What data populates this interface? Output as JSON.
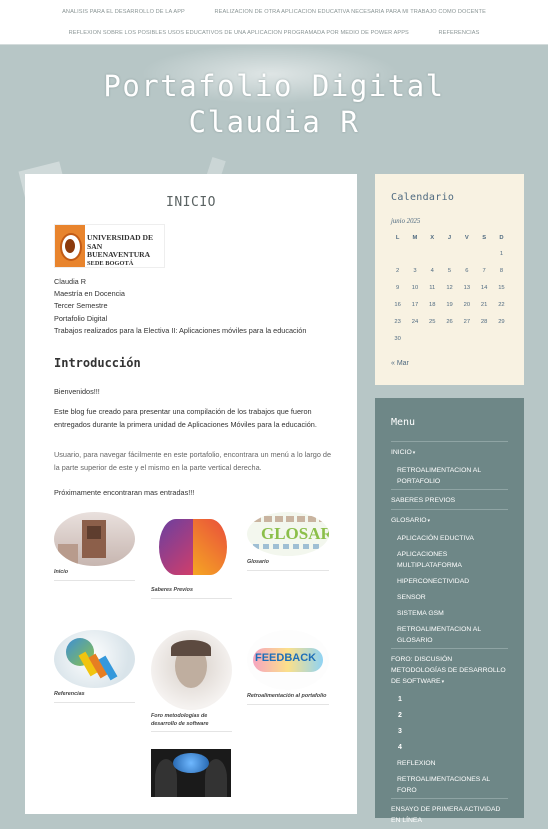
{
  "nav": {
    "row1": [
      "ANALISIS PARA EL DESARROLLO DE LA APP",
      "REALIZACION DE OTRA APLICACION EDUCATIVA NECESARIA PARA MI TRABAJO COMO DOCENTE"
    ],
    "row2": [
      "REFLEXION SOBRE LOS POSIBLES USOS EDUCATIVOS DE UNA APLICACION PROGRAMADA POR MEDIO DE POWER APPS",
      "REFERENCIAS"
    ]
  },
  "site": {
    "title_line1": "Portafolio Digital",
    "title_line2": "Claudia R"
  },
  "post": {
    "title": "INICIO",
    "logo_text": [
      "UNIVERSIDAD DE",
      "SAN BUENAVENTURA",
      "SEDE BOGOTÁ"
    ],
    "info_lines": [
      "Claudia R",
      "Maestría en Docencia",
      "Tercer Semestre",
      "Portafolio Digital",
      "Trabajos realizados para la Electiva II: Aplicaciones móviles para la educación"
    ],
    "intro_heading": "Introducción",
    "welcome": "Bienvenidos!!!",
    "para1": "Este blog fue creado para presentar una compilación de los trabajos que fueron entregados durante la primera unidad de Aplicaciones Móviles para la educación.",
    "para2": "Usuario, para navegar fácilmente en este portafolio, encontrara un menú a lo largo de la parte superior de este y el mismo en la parte vertical derecha.",
    "para3": "Próximamente encontraran mas entradas!!!",
    "thumbs": [
      "Inicio",
      "Saberes Previos",
      "Glosario",
      "Referencias",
      "Foro metodologías de desarrollo de software",
      "Retroalimentación al portafolio"
    ]
  },
  "calendar": {
    "title": "Calendario",
    "month": "junio 2025",
    "weekdays": [
      "L",
      "M",
      "X",
      "J",
      "V",
      "S",
      "D"
    ],
    "weeks": [
      [
        "",
        "",
        "",
        "",
        "",
        "",
        "1"
      ],
      [
        "2",
        "3",
        "4",
        "5",
        "6",
        "7",
        "8"
      ],
      [
        "9",
        "10",
        "11",
        "12",
        "13",
        "14",
        "15"
      ],
      [
        "16",
        "17",
        "18",
        "19",
        "20",
        "21",
        "22"
      ],
      [
        "23",
        "24",
        "25",
        "26",
        "27",
        "28",
        "29"
      ],
      [
        "30",
        "",
        "",
        "",
        "",
        "",
        ""
      ]
    ],
    "prev": "« Mar"
  },
  "menu": {
    "title": "Menu",
    "items": [
      {
        "type": "item",
        "label": "INICIO",
        "caret": true
      },
      {
        "type": "sub",
        "label": "RETROALIMENTACION AL PORTAFOLIO"
      },
      {
        "type": "item",
        "label": "SABERES PREVIOS"
      },
      {
        "type": "item",
        "label": "GLOSARIO",
        "caret": true
      },
      {
        "type": "sub",
        "label": "APLICACIÓN EDUCTIVA"
      },
      {
        "type": "sub",
        "label": "APLICACIONES MULTIPLATAFORMA"
      },
      {
        "type": "sub",
        "label": "HIPERCONECTIVIDAD"
      },
      {
        "type": "sub",
        "label": "SENSOR"
      },
      {
        "type": "sub",
        "label": "SISTEMA GSM"
      },
      {
        "type": "sub",
        "label": "RETROALIMENTACION AL GLOSARIO"
      },
      {
        "type": "item",
        "label": "FORO: DISCUSIÓN METODOLOGÍAS DE DESARROLLO DE SOFTWARE",
        "caret": true
      },
      {
        "type": "num",
        "label": "1"
      },
      {
        "type": "num",
        "label": "2"
      },
      {
        "type": "num",
        "label": "3"
      },
      {
        "type": "num",
        "label": "4"
      },
      {
        "type": "sub",
        "label": "REFLEXION"
      },
      {
        "type": "sub",
        "label": "RETROALIMENTACIONES AL FORO"
      },
      {
        "type": "item",
        "label": "ENSAYO DE PRIMERA ACTIVIDAD EN LÍNEA"
      }
    ]
  }
}
